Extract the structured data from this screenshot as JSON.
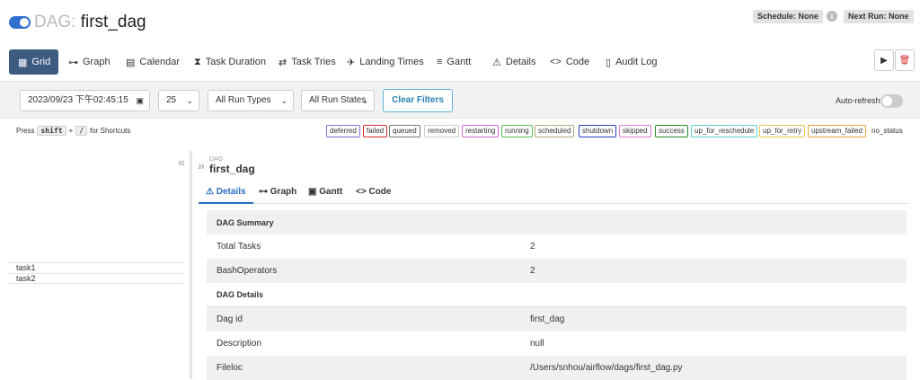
{
  "header": {
    "dag_prefix": "DAG:",
    "dag_name": "first_dag",
    "schedule": "Schedule: None",
    "next_run": "Next Run: None",
    "info": "i"
  },
  "nav": {
    "items": [
      {
        "label": "Grid",
        "icon": "grid-icon"
      },
      {
        "label": "Graph",
        "icon": "graph-icon"
      },
      {
        "label": "Calendar",
        "icon": "calendar-icon"
      },
      {
        "label": "Task Duration",
        "icon": "hourglass-icon"
      },
      {
        "label": "Task Tries",
        "icon": "retry-icon"
      },
      {
        "label": "Landing Times",
        "icon": "landing-icon"
      },
      {
        "label": "Gantt",
        "icon": "gantt-icon"
      },
      {
        "label": "Details",
        "icon": "warning-icon"
      },
      {
        "label": "Code",
        "icon": "code-icon"
      },
      {
        "label": "Audit Log",
        "icon": "file-icon"
      }
    ]
  },
  "filters": {
    "date": "2023/09/23 下午02:45:15",
    "limit": "25",
    "run_types": "All Run Types",
    "run_states": "All Run States",
    "clear": "Clear Filters",
    "auto_refresh": "Auto-refresh"
  },
  "shortcut": {
    "press": "Press",
    "key1": "shift",
    "plus": "+",
    "key2": "/",
    "suffix": "for Shortcuts"
  },
  "states": [
    {
      "label": "deferred",
      "color": "#8a6fd6"
    },
    {
      "label": "failed",
      "color": "#d22c2c"
    },
    {
      "label": "queued",
      "color": "#777777"
    },
    {
      "label": "removed",
      "color": "#cccccc"
    },
    {
      "label": "restarting",
      "color": "#d066d0"
    },
    {
      "label": "running",
      "color": "#55c055"
    },
    {
      "label": "scheduled",
      "color": "#b5a67a"
    },
    {
      "label": "shutdown",
      "color": "#2a3cc0"
    },
    {
      "label": "skipped",
      "color": "#e07ad6"
    },
    {
      "label": "success",
      "color": "#2b8a2b"
    },
    {
      "label": "up_for_reschedule",
      "color": "#5fd0d0"
    },
    {
      "label": "up_for_retry",
      "color": "#e8c84a"
    },
    {
      "label": "upstream_failed",
      "color": "#e8a23a"
    },
    {
      "label": "no_status",
      "color": "#ffffff"
    }
  ],
  "tasks": [
    "task1",
    "task2"
  ],
  "detail": {
    "small_label": "DAG",
    "name": "first_dag",
    "tabs": [
      "Details",
      "Graph",
      "Gantt",
      "Code"
    ],
    "summary_title": "DAG Summary",
    "summary_rows": [
      {
        "key": "Total Tasks",
        "value": "2"
      },
      {
        "key": "BashOperators",
        "value": "2"
      }
    ],
    "details_title": "DAG Details",
    "details_rows": [
      {
        "key": "Dag id",
        "value": "first_dag"
      },
      {
        "key": "Description",
        "value": "null"
      },
      {
        "key": "Fileloc",
        "value": "/Users/snhou/airflow/dags/first_dag.py"
      }
    ]
  }
}
